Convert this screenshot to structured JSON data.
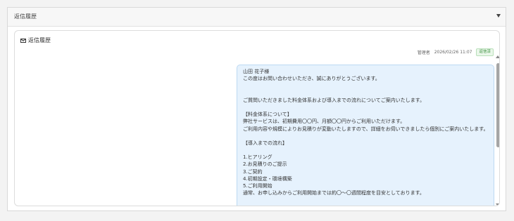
{
  "section": {
    "title": "返信履歴",
    "caret_icon": "caret-down-icon"
  },
  "card": {
    "title": "返信履歴",
    "icon": "mail-icon"
  },
  "message": {
    "sender": "管理者",
    "datetime": "2026/02/26 11:07",
    "status": "返信済",
    "lines": [
      "山田 花子様",
      "この度はお問い合わせいただき、誠にありがとうございます。",
      "",
      "",
      "ご質問いただきました料金体系および導入までの流れについてご案内いたします。",
      "",
      "【料金体系について】",
      "弊社サービスは、初期費用〇〇円、月額〇〇円からご利用いただけます。",
      "ご利用内容や規模によりお見積りが変動いたしますので、詳細をお伺いできましたら個別にご案内いたします。",
      "",
      "【導入までの流れ】",
      "",
      "1.ヒアリング",
      "2.お見積りのご提示",
      "3.ご契約",
      "4.初期設定・環境構築",
      "5.ご利用開始",
      "通常、お申し込みからご利用開始までは約〇〜〇週間程度を目安としております。"
    ]
  },
  "colors": {
    "bubble_background": "#e6f2fd",
    "bubble_border": "#bcd9f2",
    "status_badge": "#3a8f3d"
  }
}
